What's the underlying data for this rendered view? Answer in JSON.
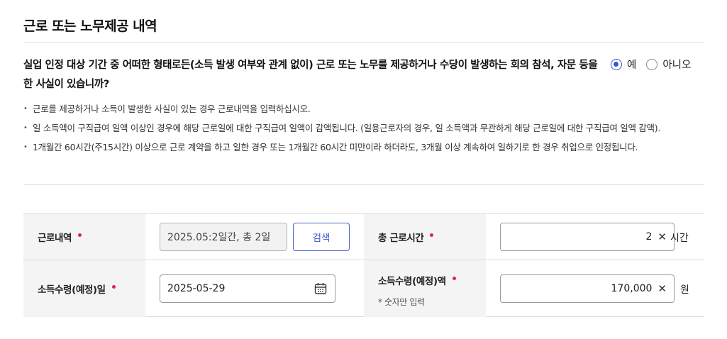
{
  "section": {
    "title": "근로 또는 노무제공 내역"
  },
  "question": {
    "text": "실업 인정 대상 기간 중 어떠한 형태로든(소득 발생 여부와 관계 없이) 근로 또는 노무를 제공하거나 수당이 발생하는 회의 참석, 자문 등을 한 사실이 있습니까?",
    "options": [
      {
        "label": "예",
        "selected": true
      },
      {
        "label": "아니오",
        "selected": false
      }
    ]
  },
  "notes": [
    "근로를 제공하거나 소득이 발생한 사실이 있는 경우 근로내역을 입력하십시오.",
    "일 소득액이 구직급여 일액 이상인 경우에 해당 근로일에 대한 구직급여 일액이 감액됩니다. (일용근로자의 경우, 일 소득액과 무관하게 해당 근로일에 대한 구직급여 일액 감액).",
    "1개월간 60시간(주15시간) 이상으로 근로 계약을 하고 일한 경우 또는 1개월간 60시간 미만이라 하더라도, 3개월 이상 계속하여 일하기로 한 경우 취업으로 인정됩니다."
  ],
  "form": {
    "work_history": {
      "label": "근로내역",
      "value": "2025.05:2일간, 총 2일",
      "search_label": "검색"
    },
    "total_hours": {
      "label": "총 근로시간",
      "value": "2",
      "unit": "시간"
    },
    "income_date": {
      "label": "소득수령(예정)일",
      "value": "2025-05-29"
    },
    "income_amount": {
      "label": "소득수령(예정)액",
      "hint": "* 숫자만 입력",
      "value": "170,000",
      "unit": "원"
    }
  },
  "icons": {
    "clear": "close-icon",
    "calendar": "calendar-icon"
  },
  "colors": {
    "accent": "#3a57c9",
    "required": "#d6245a",
    "label_bg": "#f4f4f4"
  }
}
